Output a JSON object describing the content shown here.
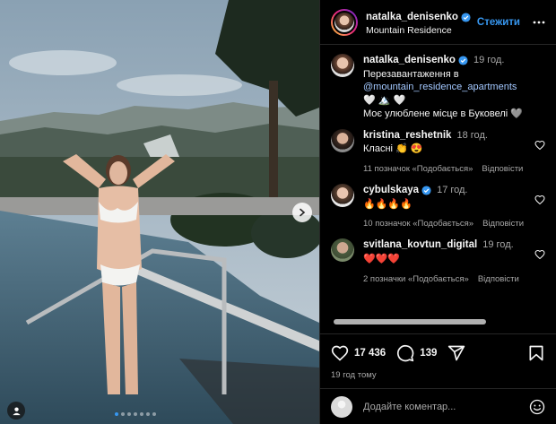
{
  "post": {
    "author": "natalka_denisenko",
    "location": "Mountain Residence",
    "follow_label": "Стежити"
  },
  "caption": {
    "author": "natalka_denisenko",
    "time": "19 год.",
    "line1": "Перезавантаження в",
    "mention": "@mountain_residence_apartments",
    "line3": "🤍 🏔️ 🤍",
    "line4": "Моє улюблене місце в Буковелі 🩶"
  },
  "comments": [
    {
      "author": "kristina_reshetnik",
      "time": "18 год.",
      "text": "Класні 👏 😍",
      "likes": "11 позначок «Подобається»",
      "reply": "Відповісти"
    },
    {
      "author": "cybulskaya",
      "time": "17 год.",
      "text": "🔥🔥🔥🔥",
      "likes": "10 позначок «Подобається»",
      "reply": "Відповісти"
    },
    {
      "author": "svitlana_kovtun_digital",
      "time": "19 год.",
      "text": "❤️❤️❤️",
      "likes": "2 позначки «Подобається»",
      "reply": "Відповісти"
    }
  ],
  "stats": {
    "likes": "17 436",
    "comments": "139",
    "posted_ago": "19 год тому"
  },
  "composer": {
    "placeholder": "Додайте коментар..."
  },
  "carousel": {
    "total": 7,
    "active": 1
  },
  "icons": [
    "verified-icon",
    "more-icon",
    "heart-icon",
    "comment-icon",
    "share-icon",
    "bookmark-icon",
    "emoji-icon",
    "chevron-right-icon",
    "user-tag-icon"
  ],
  "colors": {
    "accent": "#3797f0",
    "background": "#000000",
    "muted": "#a8a8a8"
  }
}
